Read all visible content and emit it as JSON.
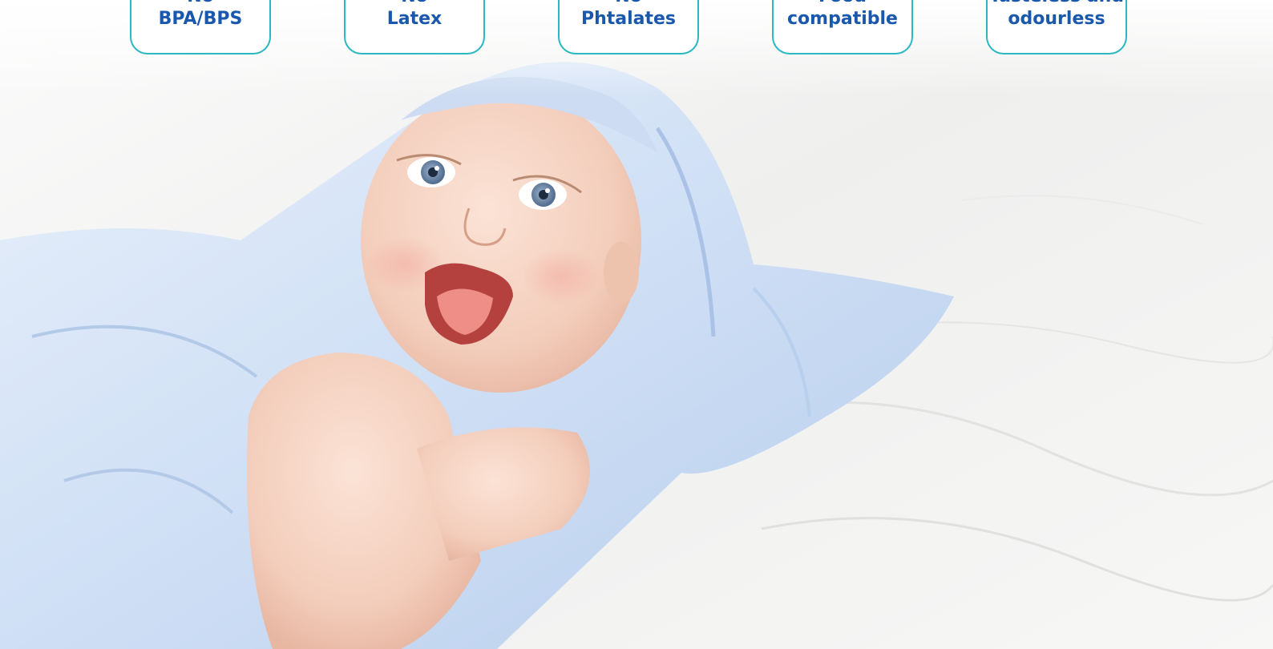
{
  "badges": [
    {
      "line1": "No",
      "line2": "BPA/BPS"
    },
    {
      "line1": "No",
      "line2": "Latex"
    },
    {
      "line1": "No",
      "line2": "Phtalates"
    },
    {
      "line1": "Food",
      "line2": "compatible"
    },
    {
      "line1": "Tasteless and",
      "line2": "odourless"
    }
  ],
  "colors": {
    "badge_border": "#2ab8c2",
    "badge_text": "#1a58ad",
    "blanket": "#cfdff5",
    "sheet": "#f2f2f1"
  },
  "photo": {
    "subject": "laughing baby under light blue blanket on white sheet"
  }
}
